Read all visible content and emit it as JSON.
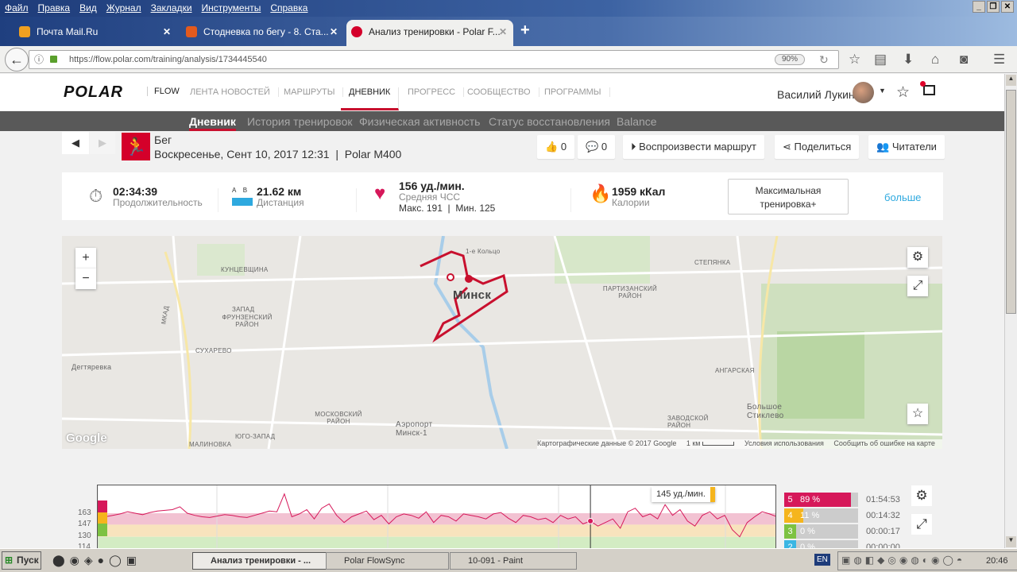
{
  "browser": {
    "menu": [
      "Файл",
      "Правка",
      "Вид",
      "Журнал",
      "Закладки",
      "Инструменты",
      "Справка"
    ],
    "tabs": [
      {
        "title": "Почта Mail.Ru"
      },
      {
        "title": "Стодневка по бегу - 8. Ста..."
      },
      {
        "title": "Анализ тренировки - Polar F..."
      }
    ],
    "url": "https://flow.polar.com/training/analysis/1734445540",
    "zoom": "90%"
  },
  "header": {
    "logo": "POLAR",
    "flow": "FLOW",
    "nav": [
      "ЛЕНТА НОВОСТЕЙ",
      "МАРШРУТЫ",
      "ДНЕВНИК",
      "ПРОГРЕСС",
      "СООБЩЕСТВО",
      "ПРОГРАММЫ"
    ],
    "user": "Василий Лукин"
  },
  "subnav": [
    "Дневник",
    "История тренировок",
    "Физическая активность",
    "Статус восстановления",
    "Balance"
  ],
  "training": {
    "sport": "Бег",
    "datetime": "Воскресенье, Сент 10, 2017 12:31  |  Polar M400",
    "likes": "0",
    "comments": "0",
    "replay": "Воспроизвести маршрут",
    "share": "Поделиться",
    "followers": "Читатели"
  },
  "stats": {
    "duration": "02:34:39",
    "duration_label": "Продолжительность",
    "dist_ab": "A    B",
    "distance": "21.62 км",
    "distance_label": "Дистанция",
    "hr": "156 уд./мин.",
    "hr_label": "Средняя ЧСС",
    "hr_minmax": "Макс. 191  |  Мин. 125",
    "calories": "1959 кКал",
    "calories_label": "Калории",
    "benefit": "Максимальная тренировка+",
    "more": "больше"
  },
  "map": {
    "labels": [
      "КУНЦЕВЩИНА",
      "ЗАПАД",
      "ФРУНЗЕНСКИЙ РАЙОН",
      "СУХАРЕВО",
      "Дегтяревка",
      "МОСКОВСКИЙ РАЙОН",
      "ЮГО-ЗАПАД",
      "МАЛИНОВКА",
      "Минск",
      "Аэропорт Минск-1",
      "ПАРТИЗАНСКИЙ РАЙОН",
      "СТЕПЯНКА",
      "АНГАРСКАЯ",
      "ЗАВОДСКОЙ РАЙОН",
      "Большое Стиклево",
      "1-е Кольцо",
      "МКАД"
    ],
    "footer": [
      "Картографические данные © 2017 Google",
      "1 км",
      "Условия использования",
      "Сообщить об ошибке на карте"
    ],
    "google": "Google"
  },
  "chart_data": {
    "type": "line",
    "title": "",
    "ylabel": "уд./мин.",
    "yticks": [
      163,
      147,
      130,
      114
    ],
    "ylim": [
      110,
      195
    ],
    "values": [
      152,
      158,
      160,
      162,
      165,
      163,
      161,
      164,
      166,
      167,
      168,
      172,
      163,
      160,
      158,
      157,
      159,
      161,
      160,
      158,
      157,
      160,
      163,
      166,
      165,
      190,
      158,
      162,
      168,
      155,
      170,
      176,
      160,
      150,
      158,
      162,
      166,
      154,
      160,
      148,
      158,
      162,
      160,
      156,
      165,
      150,
      160,
      158,
      152,
      162,
      160,
      158,
      155,
      162,
      164,
      156,
      150,
      160,
      158,
      154,
      156,
      150,
      160,
      155,
      158,
      148,
      152,
      145,
      150,
      155,
      142,
      165,
      170,
      158,
      162,
      155,
      175,
      160,
      168,
      152,
      145,
      160,
      165,
      155,
      160,
      140,
      130,
      150,
      158,
      165,
      162,
      158
    ],
    "cursor_index": 66,
    "tooltip": "145 уд./мин.",
    "zones": [
      {
        "zone": "5",
        "pct": "89 %",
        "frac": 0.89,
        "time": "01:54:53",
        "color": "#d6185a"
      },
      {
        "zone": "4",
        "pct": "11 %",
        "frac": 0.11,
        "time": "00:14:32",
        "color": "#f5b51d"
      },
      {
        "zone": "3",
        "pct": "0 %",
        "frac": 0,
        "time": "00:00:17",
        "color": "#7dc242"
      },
      {
        "zone": "2",
        "pct": "0 %",
        "frac": 0,
        "time": "00:00:00",
        "color": "#3bb6e3"
      }
    ]
  },
  "taskbar": {
    "start": "Пуск",
    "tasks": [
      "Анализ тренировки - ...",
      "Polar FlowSync",
      "10-091 - Paint"
    ],
    "lang": "EN",
    "time": "20:46"
  }
}
